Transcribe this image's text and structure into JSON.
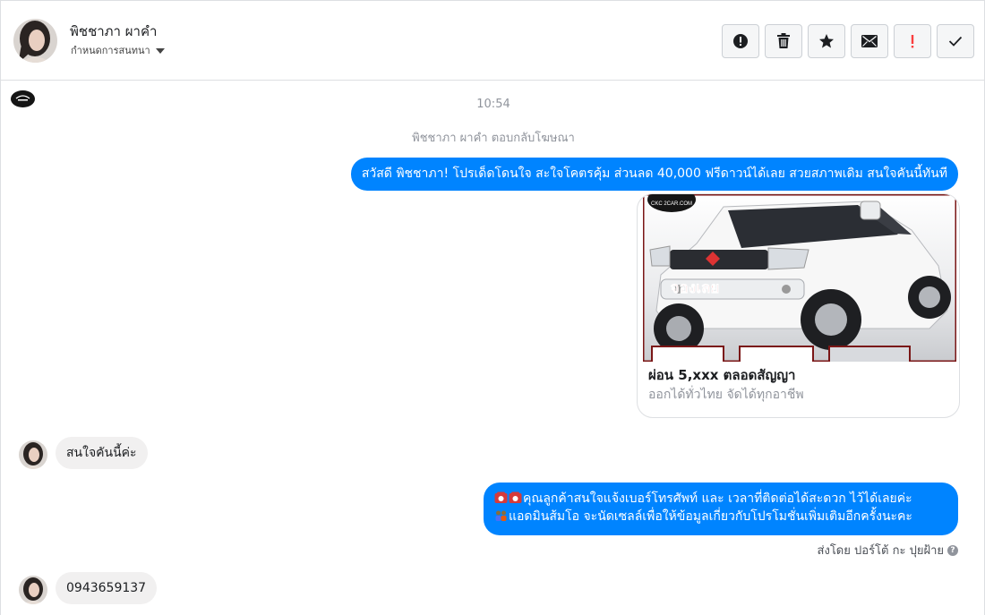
{
  "header": {
    "contact_name": "พิชชาภา ผาคำ",
    "conversation_settings": "กำหนดการสนทนา",
    "toolbar": {
      "spam_icon": "exclamation-circle",
      "delete_icon": "trash",
      "star_icon": "star",
      "unread_icon": "envelope",
      "follow_up_icon": "exclamation",
      "done_icon": "checkmark"
    }
  },
  "thread": {
    "timestamp": "10:54",
    "ad_reply_note": "พิชชาภา ผาคำ ตอบกลับโฆษณา",
    "messages": [
      {
        "direction": "out",
        "text": "สวัสดี พิชชาภา! โปรเด็ดโดนใจ สะใจโคตรคุ้ม ส่วนลด 40,000 ฟรีดาวน์ได้เลย สวยสภาพเดิม สนใจคันนี้ทันที"
      },
      {
        "direction": "out",
        "type": "ad_card",
        "image_badge": "จองเลย",
        "image_logo": "CKC 2CAR.COM",
        "title": "ผ่อน 5,xxx ตลอดสัญญา",
        "subtitle": "ออกได้ทั่วไทย จัดได้ทุกอาชีพ"
      },
      {
        "direction": "in",
        "text": "สนใจคันนี้ค่ะ"
      },
      {
        "direction": "out",
        "line1": "คุณลูกค้าสนใจแจ้งเบอร์โทรศัพท์ และ เวลาที่ติดต่อได้สะดวก ไว้ได้เลยค่ะ",
        "line2": "แอดมินส้มโอ จะนัดเซลล์เพื่อให้ข้อมูลเกี่ยวกับโปรโมชั่นเพิ่มเติมอีกครั้งนะคะ"
      },
      {
        "direction": "in",
        "text": "0943659137"
      }
    ],
    "sent_by": "ส่งโดย ปอร์โต้ กะ ปุยฝ้าย"
  },
  "colors": {
    "outgoing_bubble": "#0084ff",
    "incoming_bubble": "#f1f0f0",
    "muted_text": "#90949c"
  }
}
